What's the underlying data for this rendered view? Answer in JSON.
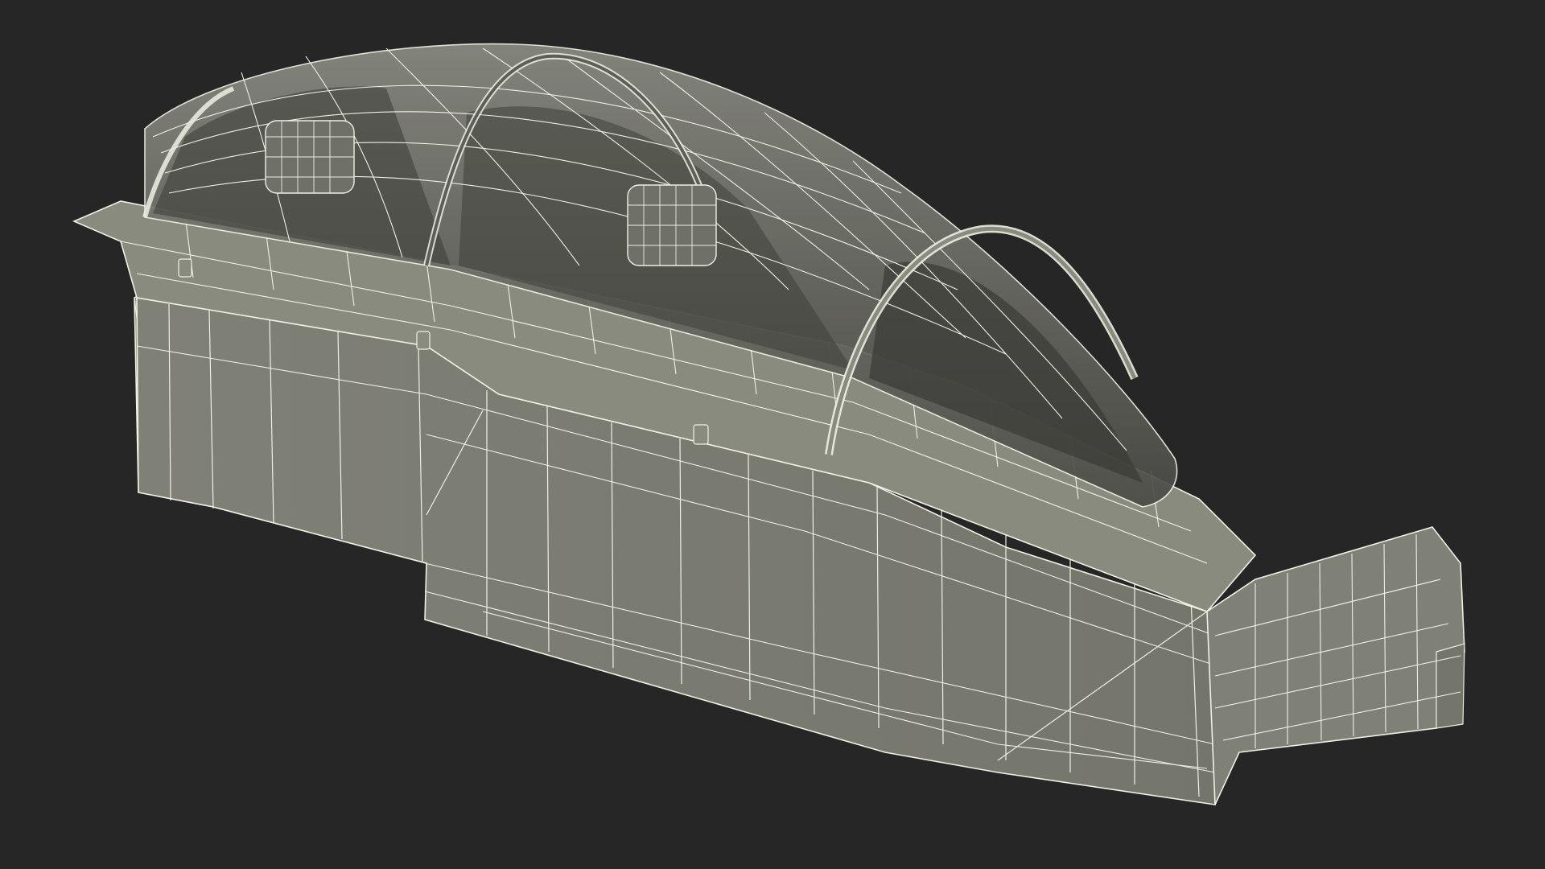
{
  "scene": {
    "subject": "cockpit-wireframe-model",
    "colors": {
      "background": "#262626",
      "hull": "#7a7b6f",
      "hull_light": "#8a8b7f",
      "hull_dark": "#6b6c62",
      "glass": "#5d5f56",
      "wire": "#eef0e4",
      "interior": "#3e3f39"
    }
  }
}
